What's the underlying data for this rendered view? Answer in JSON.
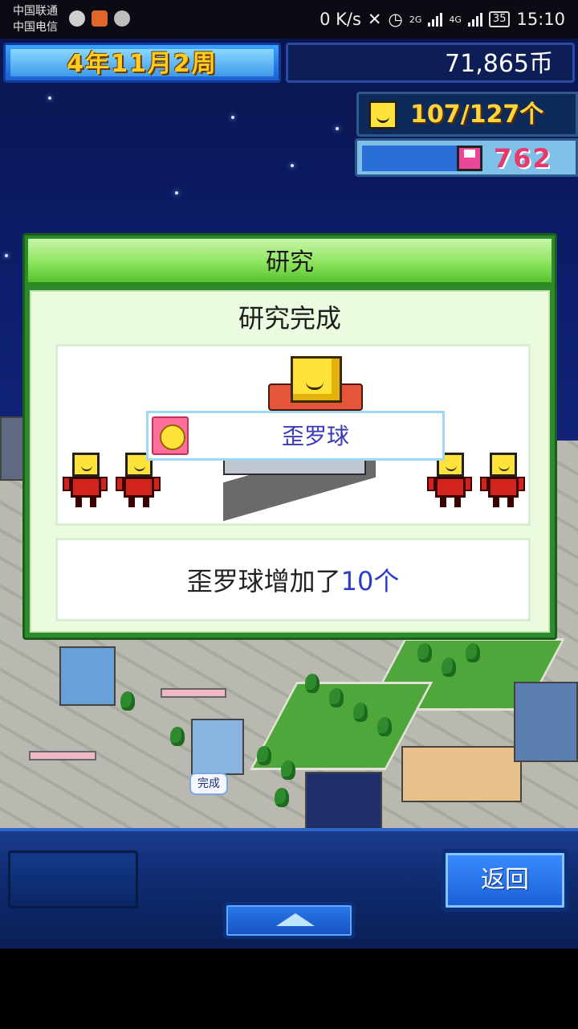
{
  "status_bar": {
    "carrier_1": "中国联通",
    "carrier_2": "中国电信",
    "speed": "0 K/s",
    "network_1": "2G",
    "network_2": "4G",
    "battery": "35",
    "time": "15:10"
  },
  "hud": {
    "date": "4年11月2周",
    "money": "71,865币",
    "population": "107/127个",
    "research_points": "762"
  },
  "dialog": {
    "title": "研究",
    "subtitle": "研究完成",
    "item_name": "歪罗球",
    "result_prefix": "歪罗球增加了",
    "result_amount": "10个"
  },
  "scene": {
    "done_label": "完成"
  },
  "bottom": {
    "back_label": "返回"
  },
  "colors": {
    "dialog_green": "#55c42f",
    "result_accent": "#2a3cc8",
    "money_yellow": "#ffd43b",
    "research_pink": "#e6396e"
  }
}
